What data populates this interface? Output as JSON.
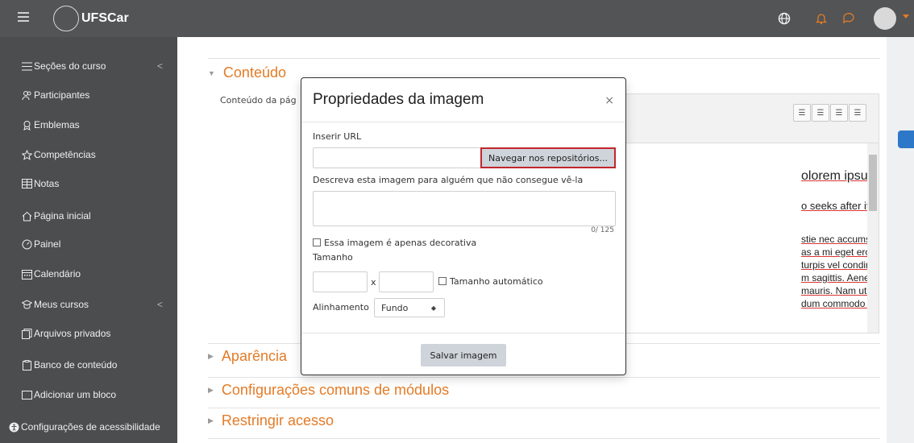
{
  "topbar": {
    "logo_text": "UFSCar",
    "accent": "#e47b26"
  },
  "sidebar": {
    "items": [
      {
        "label": "Seções do curso",
        "icon": "list-icon",
        "chevron": "<"
      },
      {
        "label": "Participantes",
        "icon": "users-icon"
      },
      {
        "label": "Emblemas",
        "icon": "badges-icon"
      },
      {
        "label": "Competências",
        "icon": "star-icon"
      },
      {
        "label": "Notas",
        "icon": "grades-icon"
      },
      {
        "label": "Página inicial",
        "icon": "home-icon"
      },
      {
        "label": "Painel",
        "icon": "dashboard-icon"
      },
      {
        "label": "Calendário",
        "icon": "calendar-icon"
      },
      {
        "label": "Meus cursos",
        "icon": "courses-icon",
        "chevron": "<"
      },
      {
        "label": "Arquivos privados",
        "icon": "files-icon"
      },
      {
        "label": "Banco de conteúdo",
        "icon": "content-bank-icon"
      },
      {
        "label": "Adicionar um bloco",
        "icon": "add-block-icon"
      },
      {
        "label": "Configurações de acessibilidade",
        "icon": "accessibility-icon"
      }
    ]
  },
  "main": {
    "sections": {
      "conteudo": "Conteúdo",
      "aparencia": "Aparência",
      "configuracoes": "Configurações comuns de módulos",
      "restringir": "Restringir acesso"
    },
    "field_label": "Conteúdo da pág",
    "editor_lines": {
      "l1": "olorem ipsum quia dolor sit amet,",
      "l2": "o seeks after it and wants to have it,",
      "l3": "stie nec accumsan mauris. Nulla facilisi.",
      "l4": "as a mi eget eros tempus ullamcorper",
      "l5": "turpis vel condimentum. Nam hendrerit",
      "l6": "m sagittis. Aenean vitae neque",
      "l7": "mauris. Nam ut mauris quis lectus",
      "l8": "dum commodo condimentum eu,"
    }
  },
  "modal": {
    "title": "Propriedades da imagem",
    "close": "×",
    "url_label": "Inserir URL",
    "browse_button": "Navegar nos repositórios...",
    "alt_label": "Descreva esta imagem para alguém que não consegue vê-la",
    "counter": "0/ 125",
    "decorative_label": "Essa imagem é apenas decorativa",
    "size_label": "Tamanho",
    "size_x": "x",
    "auto_size_label": "Tamanho automático",
    "align_label": "Alinhamento",
    "align_value": "Fundo",
    "save_button": "Salvar imagem"
  }
}
